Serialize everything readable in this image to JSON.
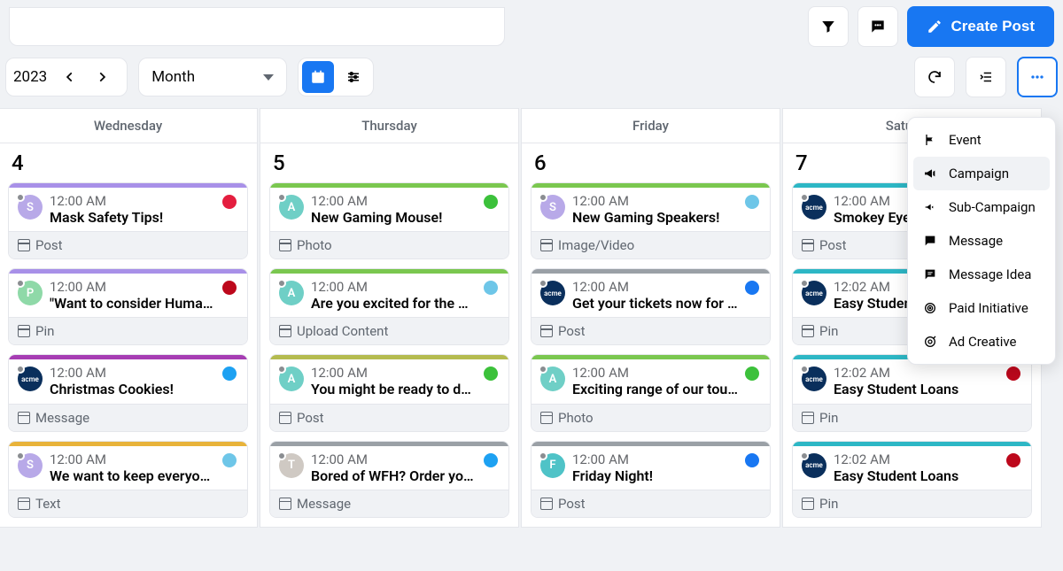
{
  "header": {
    "create_post_label": "Create Post",
    "year_label": "2023",
    "view_label": "Month"
  },
  "menu": {
    "items": [
      {
        "label": "Event",
        "icon": "flag-icon",
        "selected": false
      },
      {
        "label": "Campaign",
        "icon": "megaphone-icon",
        "selected": true
      },
      {
        "label": "Sub-Campaign",
        "icon": "megaphone-small-icon",
        "selected": false
      },
      {
        "label": "Message",
        "icon": "message-icon",
        "selected": false
      },
      {
        "label": "Message Idea",
        "icon": "message-idea-icon",
        "selected": false
      },
      {
        "label": "Paid Initiative",
        "icon": "target-icon",
        "selected": false
      },
      {
        "label": "Ad Creative",
        "icon": "at-target-icon",
        "selected": false
      }
    ]
  },
  "days": [
    {
      "name": "Wednesday",
      "number": "4",
      "cards": [
        {
          "topline": "tl-purple",
          "avatar": {
            "cls": "av-purple",
            "letter": "S"
          },
          "time": "12:00 AM",
          "title": "Mask Safety Tips!",
          "badge": "b-red",
          "footer": "Post"
        },
        {
          "topline": "tl-purple",
          "avatar": {
            "cls": "av-green",
            "letter": "P"
          },
          "time": "12:00 AM",
          "title": "\"Want to consider Human R…",
          "badge": "b-pin",
          "footer": "Pin"
        },
        {
          "topline": "tl-magenta",
          "avatar": {
            "cls": "av-blue",
            "letter": "acme"
          },
          "time": "12:00 AM",
          "title": "Christmas Cookies!",
          "badge": "b-tw",
          "footer": "Message"
        },
        {
          "topline": "tl-yellow",
          "avatar": {
            "cls": "av-purple",
            "letter": "S"
          },
          "time": "12:00 AM",
          "title": "We want to keep everyone …",
          "badge": "b-liblue",
          "footer": "Text"
        }
      ]
    },
    {
      "name": "Thursday",
      "number": "5",
      "cards": [
        {
          "topline": "tl-green",
          "avatar": {
            "cls": "av-teal",
            "letter": "A"
          },
          "time": "12:00 AM",
          "title": "New Gaming Mouse!",
          "badge": "b-green",
          "footer": "Photo"
        },
        {
          "topline": "tl-green",
          "avatar": {
            "cls": "av-teal",
            "letter": "A"
          },
          "time": "12:00 AM",
          "title": "Are you excited for the US …",
          "badge": "b-liblue",
          "footer": "Upload Content"
        },
        {
          "topline": "tl-olive",
          "avatar": {
            "cls": "av-teal",
            "letter": "A"
          },
          "time": "12:00 AM",
          "title": "You might be ready to dust …",
          "badge": "b-green",
          "footer": "Post"
        },
        {
          "topline": "tl-grey",
          "avatar": {
            "cls": "av-grey",
            "letter": "T"
          },
          "time": "12:00 AM",
          "title": "Bored of WFH? Order your f…",
          "badge": "b-tw",
          "footer": "Message"
        }
      ]
    },
    {
      "name": "Friday",
      "number": "6",
      "cards": [
        {
          "topline": "tl-green",
          "avatar": {
            "cls": "av-purple",
            "letter": "S"
          },
          "time": "12:00 AM",
          "title": "New Gaming Speakers!",
          "badge": "b-liblue",
          "footer": "Image/Video"
        },
        {
          "topline": "tl-grey",
          "avatar": {
            "cls": "av-blue",
            "letter": "acme"
          },
          "time": "12:00 AM",
          "title": "Get your tickets now for thi…",
          "badge": "b-fb",
          "footer": "Post"
        },
        {
          "topline": "tl-green",
          "avatar": {
            "cls": "av-teal",
            "letter": "A"
          },
          "time": "12:00 AM",
          "title": "Exciting range of our touch …",
          "badge": "b-green",
          "footer": "Photo"
        },
        {
          "topline": "tl-grey",
          "avatar": {
            "cls": "av-tealF",
            "letter": "F"
          },
          "time": "12:00 AM",
          "title": "Friday Night!",
          "badge": "b-fb",
          "footer": "Post"
        }
      ]
    },
    {
      "name": "Saturday",
      "number": "7",
      "cards": [
        {
          "topline": "tl-teal",
          "avatar": {
            "cls": "av-blue",
            "letter": "acme"
          },
          "time": "12:00 AM",
          "title": "Smokey Eye",
          "badge": "b-none",
          "footer": "Post"
        },
        {
          "topline": "tl-teal",
          "avatar": {
            "cls": "av-blue",
            "letter": "acme"
          },
          "time": "12:02 AM",
          "title": "Easy Student",
          "badge": "b-none",
          "footer": "Pin"
        },
        {
          "topline": "tl-teal",
          "avatar": {
            "cls": "av-blue",
            "letter": "acme"
          },
          "time": "12:02 AM",
          "title": "Easy Student Loans",
          "badge": "b-pin",
          "footer": "Pin"
        },
        {
          "topline": "tl-teal",
          "avatar": {
            "cls": "av-blue",
            "letter": "acme"
          },
          "time": "12:02 AM",
          "title": "Easy Student Loans",
          "badge": "b-pin",
          "footer": "Pin"
        }
      ]
    }
  ]
}
